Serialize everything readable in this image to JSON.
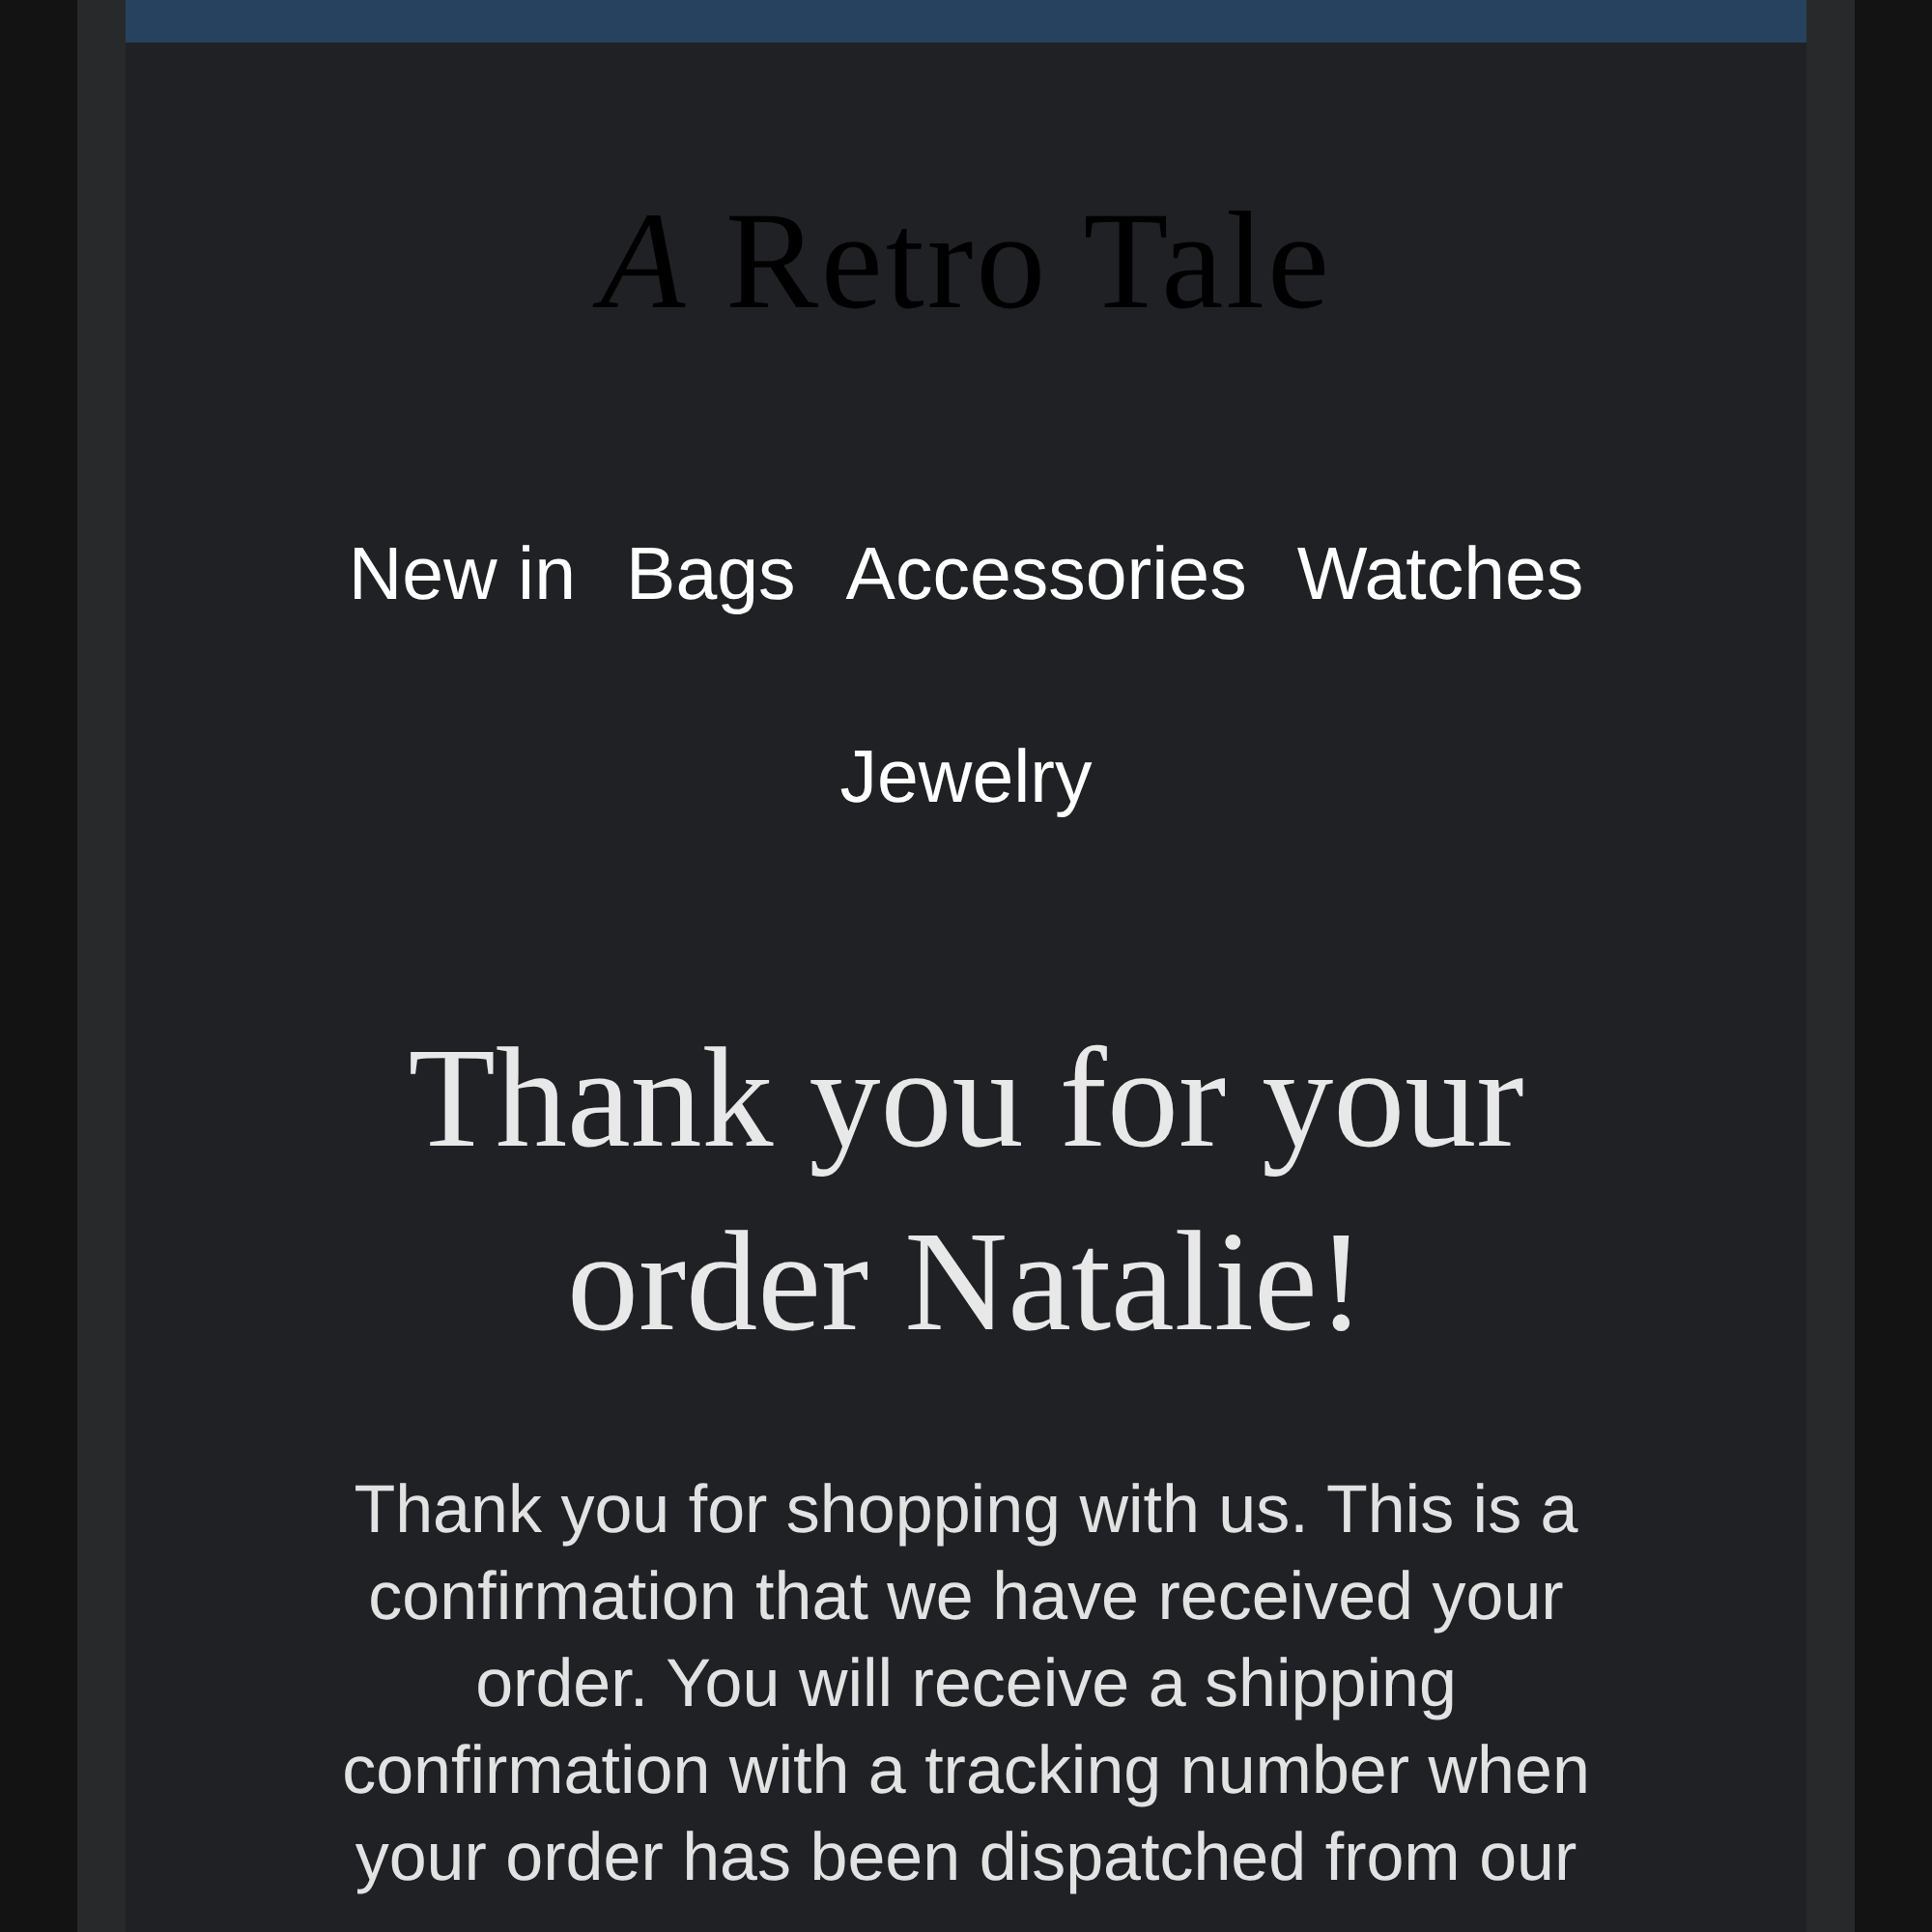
{
  "logo": "*A* Retro Tale",
  "nav": [
    "New in",
    "Bags",
    "Accessories",
    "Watches",
    "Jewelry"
  ],
  "heading": "Thank you for your order Natalie!",
  "message": "Thank you for shopping with us. This is a confirmation that we have received your order. You will receive a shipping confirmation with a tracking number when your order has been dispatched from our"
}
